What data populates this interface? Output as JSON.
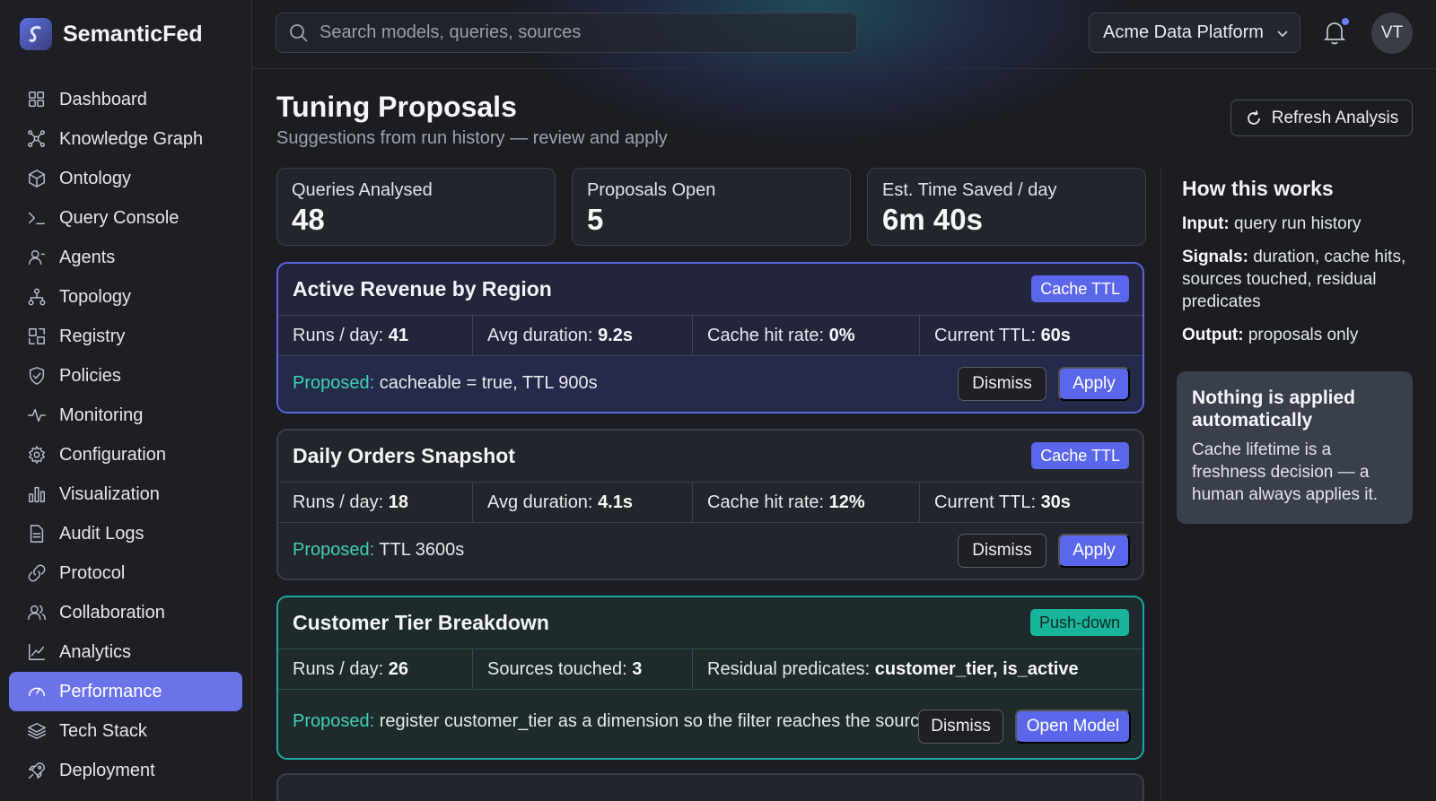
{
  "brand": {
    "name": "SemanticFed"
  },
  "sidebar": {
    "items": [
      {
        "label": "Dashboard",
        "icon": "grid-icon"
      },
      {
        "label": "Knowledge Graph",
        "icon": "graph-icon"
      },
      {
        "label": "Ontology",
        "icon": "cube-icon"
      },
      {
        "label": "Query Console",
        "icon": "terminal-icon"
      },
      {
        "label": "Agents",
        "icon": "agent-icon"
      },
      {
        "label": "Topology",
        "icon": "topology-icon"
      },
      {
        "label": "Registry",
        "icon": "registry-icon"
      },
      {
        "label": "Policies",
        "icon": "shield-icon"
      },
      {
        "label": "Monitoring",
        "icon": "pulse-icon"
      },
      {
        "label": "Configuration",
        "icon": "gear-icon"
      },
      {
        "label": "Visualization",
        "icon": "bar-chart-icon"
      },
      {
        "label": "Audit Logs",
        "icon": "document-icon"
      },
      {
        "label": "Protocol",
        "icon": "link-icon"
      },
      {
        "label": "Collaboration",
        "icon": "users-icon"
      },
      {
        "label": "Analytics",
        "icon": "line-chart-icon"
      },
      {
        "label": "Performance",
        "icon": "gauge-icon",
        "active": true
      },
      {
        "label": "Tech Stack",
        "icon": "layers-icon"
      },
      {
        "label": "Deployment",
        "icon": "rocket-icon"
      }
    ]
  },
  "topbar": {
    "search_placeholder": "Search models, queries, sources",
    "org": "Acme Data Platform",
    "avatar": "VT"
  },
  "page": {
    "title": "Tuning Proposals",
    "subtitle": "Suggestions from run history — review and apply",
    "refresh_label": "Refresh Analysis"
  },
  "stats": [
    {
      "label": "Queries Analysed",
      "value": "48"
    },
    {
      "label": "Proposals Open",
      "value": "5"
    },
    {
      "label": "Est. Time Saved / day",
      "value": "6m 40s"
    }
  ],
  "proposals": [
    {
      "title": "Active Revenue by Region",
      "tag": "Cache TTL",
      "metrics": [
        {
          "label": "Runs / day:",
          "value": "41"
        },
        {
          "label": "Avg duration:",
          "value": "9.2s"
        },
        {
          "label": "Cache hit rate:",
          "value": "0%"
        },
        {
          "label": "Current TTL:",
          "value": "60s"
        }
      ],
      "proposed_label": "Proposed:",
      "proposed_text": "cacheable = true, TTL 900s",
      "dismiss": "Dismiss",
      "action": "Apply"
    },
    {
      "title": "Daily Orders Snapshot",
      "tag": "Cache TTL",
      "metrics": [
        {
          "label": "Runs / day:",
          "value": "18"
        },
        {
          "label": "Avg duration:",
          "value": "4.1s"
        },
        {
          "label": "Cache hit rate:",
          "value": "12%"
        },
        {
          "label": "Current TTL:",
          "value": "30s"
        }
      ],
      "proposed_label": "Proposed:",
      "proposed_text": "TTL 3600s",
      "dismiss": "Dismiss",
      "action": "Apply"
    },
    {
      "title": "Customer Tier Breakdown",
      "tag": "Push-down",
      "metrics": [
        {
          "label": "Runs / day:",
          "value": "26"
        },
        {
          "label": "Sources touched:",
          "value": "3"
        },
        {
          "label": "Residual predicates:",
          "value": "customer_tier, is_active"
        }
      ],
      "proposed_label": "Proposed:",
      "proposed_text": "register customer_tier as a dimension so the filter reaches the source",
      "dismiss": "Dismiss",
      "action": "Open Model"
    }
  ],
  "how_it_works": {
    "title": "How this works",
    "input_label": "Input:",
    "input_text": "query run history",
    "signals_label": "Signals:",
    "signals_text": "duration, cache hits, sources touched, residual predicates",
    "output_label": "Output:",
    "output_text": "proposals only",
    "note_title": "Nothing is applied automatically",
    "note_body": "Cache lifetime is a freshness decision — a human always applies it."
  },
  "colors": {
    "accent": "#5b67ea",
    "teal": "#18b59b",
    "proposed": "#3fd1b5"
  }
}
